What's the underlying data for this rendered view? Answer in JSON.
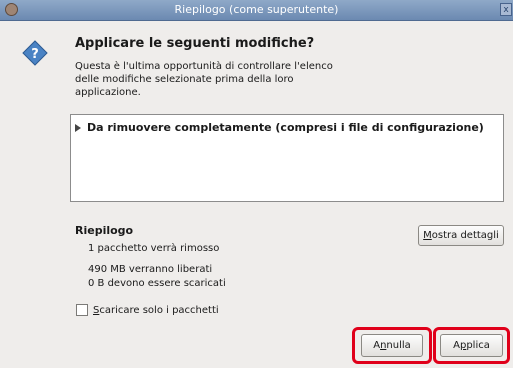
{
  "window": {
    "title": "Riepilogo (come superutente)",
    "close_glyph": "x",
    "app_icon": "user-icon"
  },
  "dialog": {
    "icon": "question-icon",
    "heading": "Applicare le seguenti modifiche?",
    "intro": "Questa è l'ultima opportunità di controllare l'elenco\ndelle modifiche selezionate prima della loro\napplicazione."
  },
  "changes": {
    "items": [
      {
        "label": "Da rimuovere completamente (compresi i file di configurazione)",
        "expanded": false
      }
    ]
  },
  "summary": {
    "heading": "Riepilogo",
    "lines": [
      "1 pacchetto verrà rimosso",
      "490 MB verranno liberati",
      "0  B devono essere scaricati"
    ],
    "details_button": {
      "mnemonic": "M",
      "rest": "ostra dettagli"
    }
  },
  "download_only": {
    "checked": false,
    "mnemonic": "S",
    "rest": "caricare solo i pacchetti"
  },
  "buttons": {
    "cancel": {
      "pre": "A",
      "mnemonic": "n",
      "rest": "nulla"
    },
    "apply": {
      "pre": "A",
      "mnemonic": "p",
      "rest": "plica"
    }
  },
  "highlight_color": "#e0001a"
}
